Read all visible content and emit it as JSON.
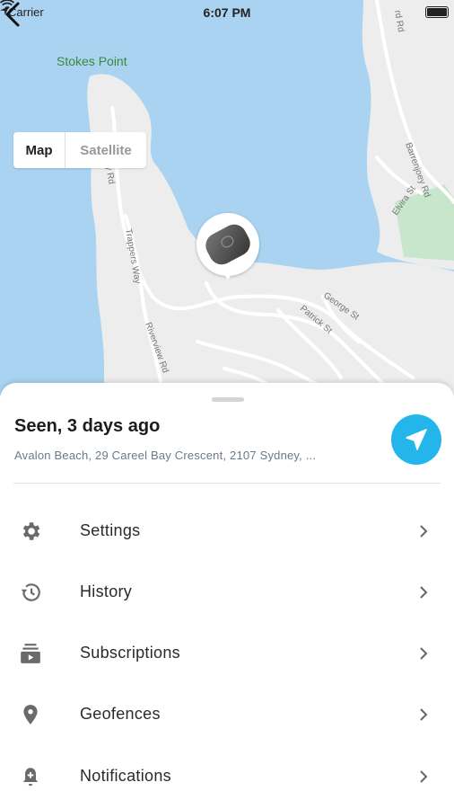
{
  "status_bar": {
    "carrier": "Carrier",
    "time": "6:07 PM"
  },
  "map": {
    "place_label": "Stokes Point",
    "road_labels": [
      "Barrenjoey Rd",
      "Elvira St",
      "George St",
      "Patrick St",
      "Riverview Rd",
      "Trappers Way",
      "y Rd",
      "rd Rd"
    ],
    "view_toggle": {
      "map_label": "Map",
      "satellite_label": "Satellite",
      "selected": "Map"
    },
    "colors": {
      "water": "#a9d3f0",
      "land": "#ededed",
      "park": "#c7e6cb"
    }
  },
  "sheet": {
    "title": "Seen, 3 days ago",
    "address": "Avalon Beach, 29 Careel Bay Crescent, 2107 Sydney, ...",
    "navigate_icon": "navigation-arrow-icon",
    "accent_color": "#24b6ea",
    "menu": [
      {
        "label": "Settings",
        "icon": "gear-icon"
      },
      {
        "label": "History",
        "icon": "history-icon"
      },
      {
        "label": "Subscriptions",
        "icon": "subscriptions-icon"
      },
      {
        "label": "Geofences",
        "icon": "location-pin-icon"
      },
      {
        "label": "Notifications",
        "icon": "notification-add-icon"
      }
    ]
  }
}
